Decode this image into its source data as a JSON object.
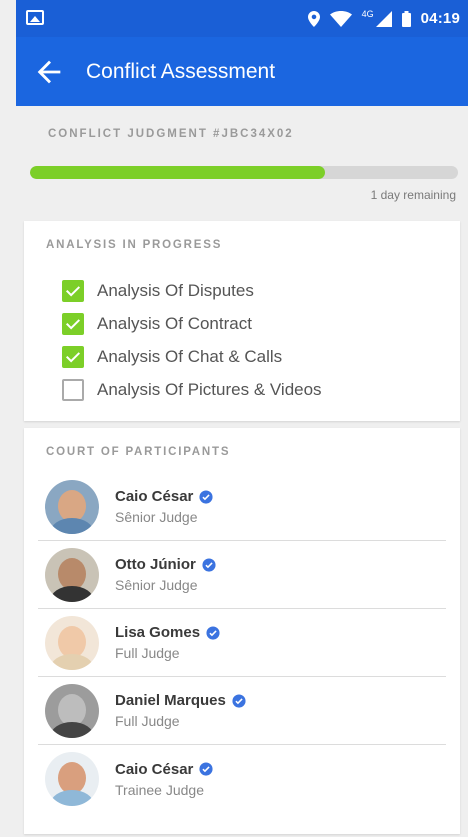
{
  "status_bar": {
    "network": "4G",
    "time": "04:19"
  },
  "app_bar": {
    "title": "Conflict Assessment"
  },
  "judgment": {
    "label": "CONFLICT JUDGMENT #JBC34X02",
    "progress": 0.69,
    "remaining": "1 day remaining"
  },
  "analysis": {
    "title": "ANALYSIS IN PROGRESS",
    "items": [
      {
        "label": "Analysis Of Disputes",
        "checked": true
      },
      {
        "label": "Analysis Of Contract",
        "checked": true
      },
      {
        "label": "Analysis Of Chat & Calls",
        "checked": true
      },
      {
        "label": "Analysis Of Pictures & Videos",
        "checked": false
      }
    ]
  },
  "court": {
    "title": "COURT OF PARTICIPANTS",
    "participants": [
      {
        "name": "Caio César",
        "role": "Sênior Judge"
      },
      {
        "name": "Otto Júnior",
        "role": "Sênior Judge"
      },
      {
        "name": "Lisa Gomes",
        "role": "Full Judge"
      },
      {
        "name": "Daniel Marques",
        "role": "Full Judge"
      },
      {
        "name": "Caio César",
        "role": "Trainee Judge"
      }
    ]
  },
  "colors": {
    "primary": "#1b66e0",
    "accent": "#7ccf28",
    "verified": "#3b73e0"
  }
}
